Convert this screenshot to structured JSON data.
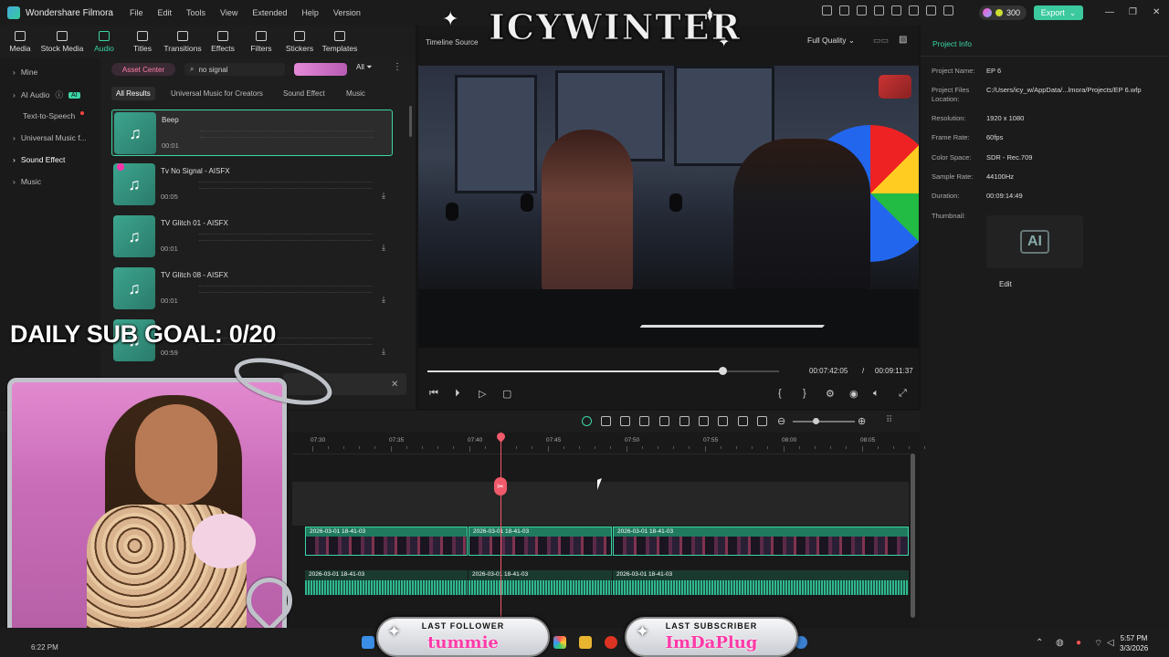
{
  "app": {
    "name": "Wondershare Filmora",
    "menus": [
      "File",
      "Edit",
      "Tools",
      "View",
      "Extended",
      "Help",
      "Version"
    ],
    "credits": "300",
    "export_label": "Export"
  },
  "toolbar": {
    "items": [
      "Media",
      "Stock Media",
      "Audio",
      "Titles",
      "Transitions",
      "Effects",
      "Filters",
      "Stickers",
      "Templates"
    ]
  },
  "leftnav": {
    "items": [
      "Mine",
      "AI Audio",
      "Text-to-Speech",
      "Universal Music f...",
      "Sound Effect",
      "Music"
    ],
    "ai_badge": "AI"
  },
  "library": {
    "asset_center": "Asset Center",
    "search_value": "no signal",
    "all_label": "All",
    "filters": [
      "All Results",
      "Universal Music for Creators",
      "Sound Effect",
      "Music"
    ],
    "tracks": [
      {
        "name": "Beep",
        "duration": "00:01"
      },
      {
        "name": "Tv No Signal - AISFX",
        "duration": "00:05"
      },
      {
        "name": "TV Glitch 01 - AISFX",
        "duration": "00:01"
      },
      {
        "name": "TV Glitch 08 - AISFX",
        "duration": "00:01"
      },
      {
        "name": "",
        "duration": "00:59"
      }
    ]
  },
  "preview": {
    "tabs": "Timeline  Source",
    "quality": "Full Quality",
    "current_time": "00:07:42:05",
    "separator": "/",
    "total_time": "00:09:11:37",
    "progress": 0.84
  },
  "project_info": {
    "title": "Project Info",
    "fields": [
      {
        "label": "Project Name:",
        "value": "EP 6"
      },
      {
        "label": "Project Files Location:",
        "value": "C:/Users/icy_w/AppData/...lmora/Projects/EP 6.wfp"
      },
      {
        "label": "Resolution:",
        "value": "1920 x 1080"
      },
      {
        "label": "Frame Rate:",
        "value": "60fps"
      },
      {
        "label": "Color Space:",
        "value": "SDR - Rec.709"
      },
      {
        "label": "Sample Rate:",
        "value": "44100Hz"
      },
      {
        "label": "Duration:",
        "value": "00:09:14:49"
      },
      {
        "label": "Thumbnail:",
        "value": ""
      }
    ],
    "thumbnail_text": "AI",
    "edit_label": "Edit"
  },
  "timeline": {
    "ruler": [
      "07:30",
      "07:35",
      "07:40",
      "07:45",
      "07:50",
      "07:55",
      "08:00",
      "08:05"
    ],
    "video_clips": [
      "2026-03-01 18-41-03",
      "2026-03-01 18-41-03",
      "2026-03-01 18-41-03"
    ],
    "audio_clips": [
      "2026-03-01 18-41-03",
      "2026-03-01 18-41-03",
      "2026-03-01 18-41-03"
    ]
  },
  "overlay": {
    "stream_title": "ICYWINTER",
    "sub_goal": "DAILY SUB GOAL: 0/20",
    "last_follower_label": "LAST FOLLOWER",
    "last_follower_name": "tummie",
    "last_subscriber_label": "LAST SUBSCRIBER",
    "last_subscriber_name": "ImDaPlug",
    "cam_time": "6:22 PM"
  },
  "taskbar": {
    "time": "5:57 PM",
    "date": "3/3/2026"
  },
  "colors": {
    "accent": "#3bd6a7",
    "playhead": "#f05a6a",
    "asset_pink": "#ff7ea8"
  }
}
